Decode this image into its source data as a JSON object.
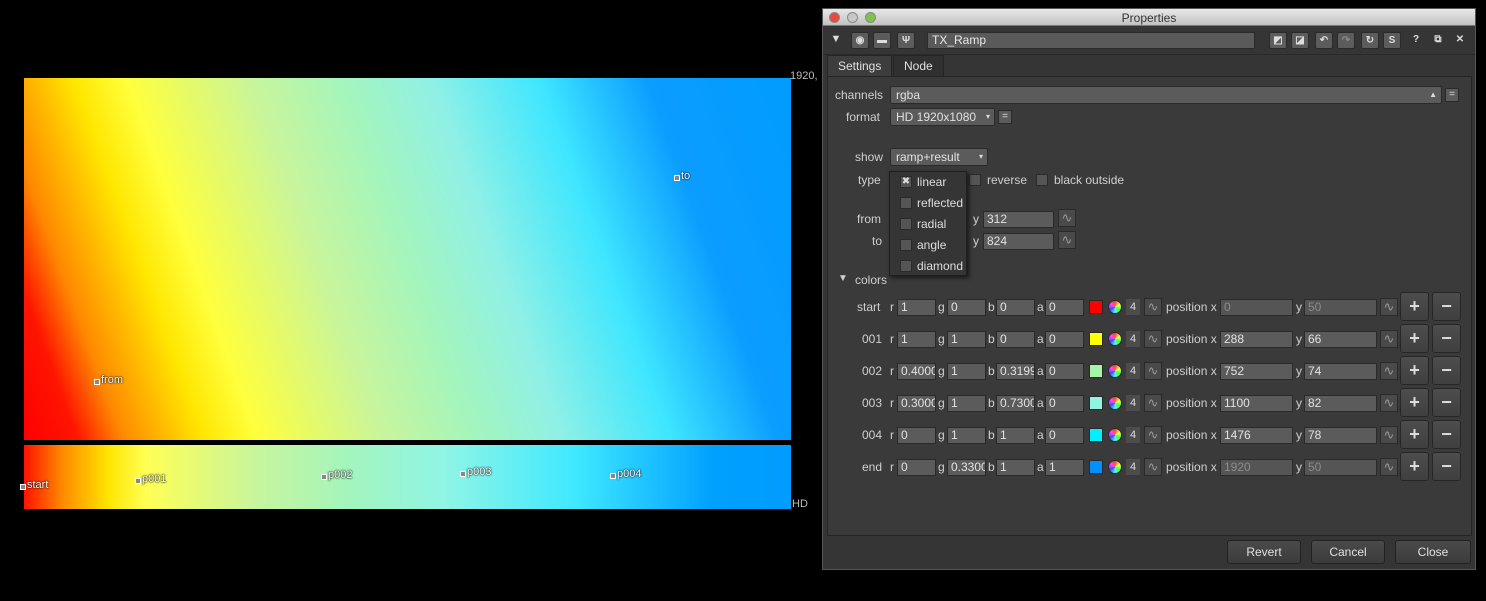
{
  "viewer": {
    "corner_tr": "1920,",
    "corner_br": "HD",
    "handles": {
      "to": "to",
      "from": "from",
      "start": "start",
      "p001": "p001",
      "p002": "p002",
      "p003": "p003",
      "p004": "p004"
    }
  },
  "window": {
    "title": "Properties"
  },
  "toolbar": {
    "node_name": "TX_Ramp"
  },
  "tabs": [
    {
      "label": "Settings"
    },
    {
      "label": "Node"
    }
  ],
  "settings": {
    "channels": {
      "label": "channels",
      "value": "rgba"
    },
    "format": {
      "label": "format",
      "value": "HD 1920x1080"
    },
    "show": {
      "label": "show",
      "value": "ramp+result"
    },
    "type": {
      "label": "type",
      "reverse": "reverse",
      "black_outside": "black outside"
    },
    "type_menu": [
      {
        "label": "linear",
        "checked": true
      },
      {
        "label": "reflected",
        "checked": false
      },
      {
        "label": "radial",
        "checked": false
      },
      {
        "label": "angle",
        "checked": false
      },
      {
        "label": "diamond",
        "checked": false
      }
    ],
    "from": {
      "label": "from",
      "y_label": "y",
      "y": "312"
    },
    "to": {
      "label": "to",
      "y_label": "y",
      "y": "824"
    },
    "colors_label": "colors"
  },
  "color_rows": [
    {
      "name": "start",
      "r": "1",
      "g": "0",
      "b": "0",
      "a": "0",
      "swatch": "#ff0000",
      "count": "4",
      "pos_label": "position x",
      "x": "0",
      "y": "50",
      "dim": true
    },
    {
      "name": "001",
      "r": "1",
      "g": "1",
      "b": "0",
      "a": "0",
      "swatch": "#ffff00",
      "count": "4",
      "pos_label": "position x",
      "x": "288",
      "y": "66",
      "dim": false
    },
    {
      "name": "002",
      "r": "0.4000",
      "g": "1",
      "b": "0.3199",
      "a": "0",
      "swatch": "#a6f5a8",
      "count": "4",
      "pos_label": "position x",
      "x": "752",
      "y": "74",
      "dim": false
    },
    {
      "name": "003",
      "r": "0.3000",
      "g": "1",
      "b": "0.7300",
      "a": "0",
      "swatch": "#8ff5e0",
      "count": "4",
      "pos_label": "position x",
      "x": "1100",
      "y": "82",
      "dim": false
    },
    {
      "name": "004",
      "r": "0",
      "g": "1",
      "b": "1",
      "a": "0",
      "swatch": "#00f0ff",
      "count": "4",
      "pos_label": "position x",
      "x": "1476",
      "y": "78",
      "dim": false
    },
    {
      "name": "end",
      "r": "0",
      "g": "0.3300",
      "b": "1",
      "a": "1",
      "swatch": "#0090ff",
      "count": "4",
      "pos_label": "position x",
      "x": "1920",
      "y": "50",
      "dim": true
    }
  ],
  "channel_labels": {
    "r": "r",
    "g": "g",
    "b": "b",
    "a": "a",
    "y": "y"
  },
  "footer": {
    "revert": "Revert",
    "cancel": "Cancel",
    "close": "Close"
  }
}
